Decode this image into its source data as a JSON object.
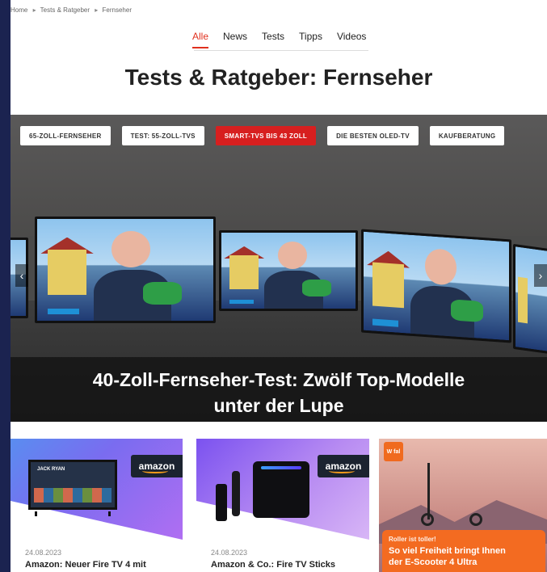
{
  "breadcrumb": [
    "Home",
    "Tests & Ratgeber",
    "Fernseher"
  ],
  "nav": {
    "tabs": [
      "Alle",
      "News",
      "Tests",
      "Tipps",
      "Videos"
    ],
    "active": "Alle"
  },
  "page_title": "Tests & Ratgeber: Fernseher",
  "hero": {
    "pills": [
      "65-ZOLL-FERNSEHER",
      "TEST: 55-ZOLL-TVS",
      "SMART-TVS BIS 43 ZOLL",
      "DIE BESTEN OLED-TV",
      "KAUFBERATUNG"
    ],
    "active_pill": "SMART-TVS BIS 43 ZOLL",
    "caption_line1": "40-Zoll-Fernseher-Test: Zwölf Top-Modelle",
    "caption_line2": "unter der Lupe",
    "prev_arrow": "‹",
    "next_arrow": "›"
  },
  "cards": [
    {
      "brand": "amazon",
      "date": "24.08.2023",
      "title": "Amazon: Neuer Fire TV 4 mit",
      "tv_label": "JACK RYAN"
    },
    {
      "brand": "amazon",
      "date": "24.08.2023",
      "title": "Amazon & Co.: Fire TV Sticks"
    }
  ],
  "ad": {
    "badge": "W fal",
    "kicker": "Roller ist toller!",
    "headline_line1": "So viel Freiheit bringt Ihnen",
    "headline_line2": "der E-Scooter 4 Ultra"
  },
  "colors": {
    "accent": "#e0301e",
    "pill_active": "#d71f1f",
    "frame": "#1b2350",
    "ad_orange": "#f36b21"
  }
}
